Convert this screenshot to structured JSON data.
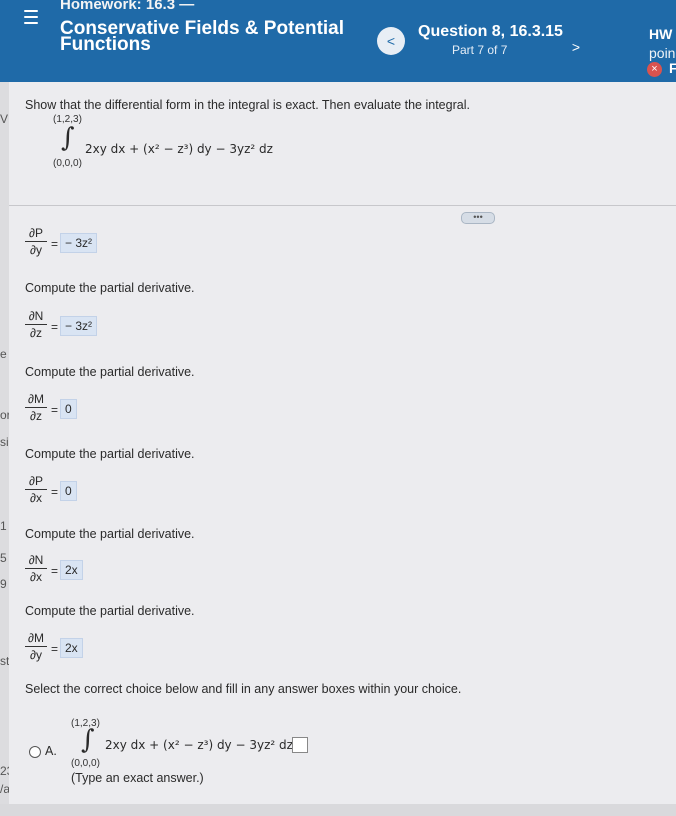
{
  "header": {
    "homework_line1": "Homework: 16.3 —",
    "homework_line2": "Conservative Fields & Potential",
    "homework_line3": "Functions",
    "question_title": "Question 8, 16.3.15",
    "part_label": "Part 7 of 7",
    "prev_label": "<",
    "next_label": ">",
    "hw_label": "HW",
    "points_label": "poin",
    "close_label": "×",
    "trunc_label": "F"
  },
  "edge": {
    "chars": [
      "V",
      "e",
      "or",
      "si",
      "1",
      "5",
      "9",
      "st",
      "23",
      "/a"
    ]
  },
  "problem": {
    "prompt": "Show that the differential form in the integral is exact. Then evaluate the integral.",
    "upper": "(1,2,3)",
    "lower": "(0,0,0)",
    "integrand": "2xy dx + (x² − z³) dy − 3yz² dz"
  },
  "more_label": "•••",
  "steps": [
    {
      "num": "∂P",
      "den": "∂y",
      "answer": "− 3z²",
      "instruction": ""
    },
    {
      "num": "∂N",
      "den": "∂z",
      "answer": "− 3z²",
      "instruction": "Compute the partial derivative."
    },
    {
      "num": "∂M",
      "den": "∂z",
      "answer": "0",
      "instruction": "Compute the partial derivative."
    },
    {
      "num": "∂P",
      "den": "∂x",
      "answer": "0",
      "instruction": "Compute the partial derivative."
    },
    {
      "num": "∂N",
      "den": "∂x",
      "answer": "2x",
      "instruction": "Compute the partial derivative."
    },
    {
      "num": "∂M",
      "den": "∂y",
      "answer": "2x",
      "instruction": "Compute the partial derivative."
    }
  ],
  "choice_prompt": "Select the correct choice below and fill in any answer boxes within your choice.",
  "choice_a": {
    "label": "A.",
    "upper": "(1,2,3)",
    "lower": "(0,0,0)",
    "integrand": "2xy dx + (x² − z³) dy − 3yz² dz =",
    "hint": "(Type an exact answer.)"
  },
  "colors": {
    "header": "#1f6aa8",
    "answer_bg": "#d9e4f3",
    "close": "#d9534f"
  }
}
